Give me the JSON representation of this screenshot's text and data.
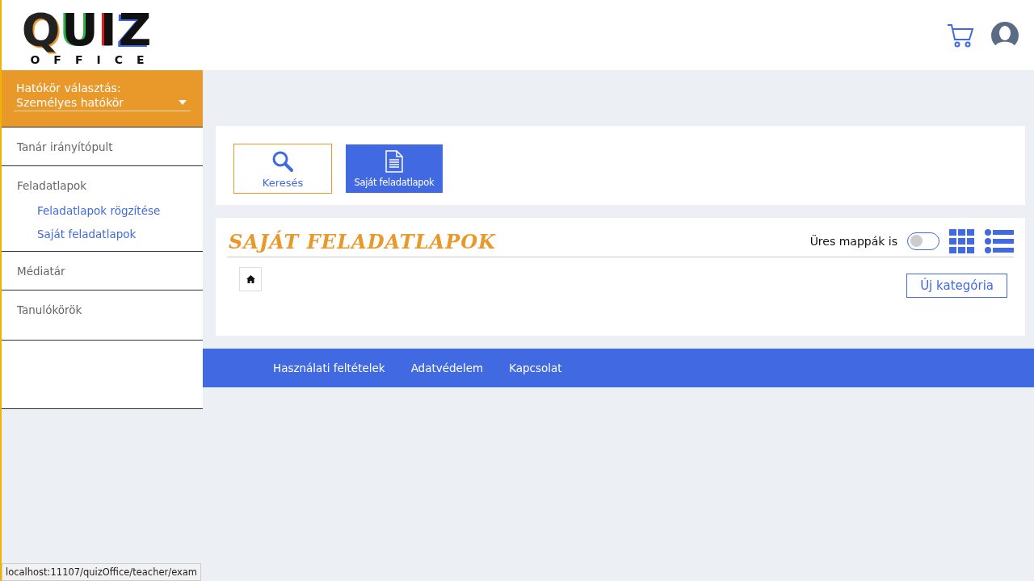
{
  "header": {
    "logo": {
      "top": "QUIZ",
      "bottom": "OFFICE"
    }
  },
  "scope": {
    "label": "Hatókör választás:",
    "value": "Személyes hatókör"
  },
  "sidebar": {
    "items": [
      {
        "label": "Tanár irányítópult"
      },
      {
        "label": "Feladatlapok",
        "children": [
          {
            "label": "Feladatlapok rögzítése"
          },
          {
            "label": "Saját feladatlapok"
          }
        ]
      },
      {
        "label": "Médiatár"
      },
      {
        "label": "Tanulókörök"
      }
    ]
  },
  "tiles": [
    {
      "kind": "search",
      "label": "Keresés",
      "selected": false
    },
    {
      "kind": "document",
      "label": "Saját feladatlapok",
      "selected": true
    }
  ],
  "section": {
    "title": "SAJÁT FELADATLAPOK",
    "toggle": {
      "label": "Üres mappák is",
      "on": false
    },
    "new_button": "Új kategória"
  },
  "footer": {
    "links": [
      "Használati feltételek",
      "Adatvédelem",
      "Kapcsolat"
    ]
  },
  "status_bar": "localhost:11107/quizOffice/teacher/exam"
}
